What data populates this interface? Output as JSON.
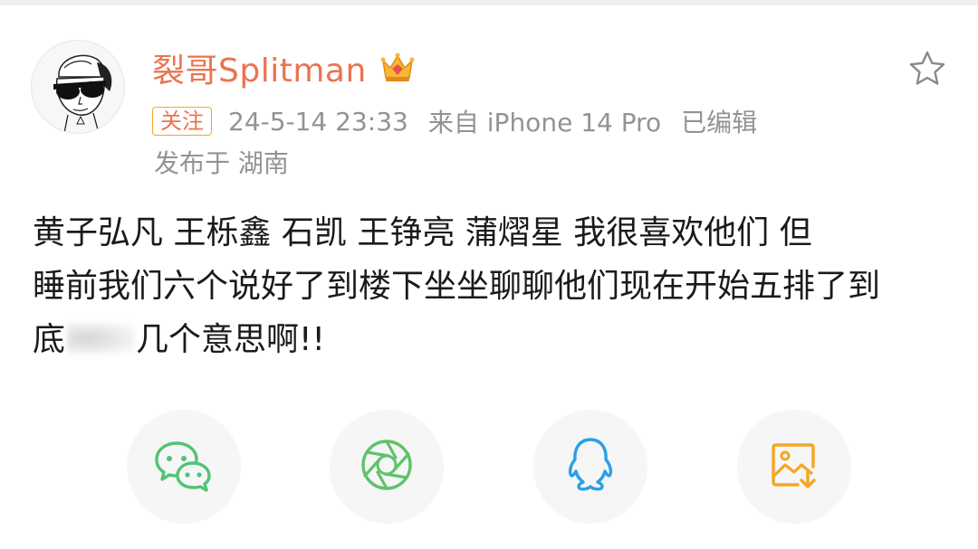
{
  "post": {
    "username": "裂哥Splitman",
    "follow_label": "关注",
    "timestamp": "24-5-14 23:33",
    "source": "来自 iPhone 14 Pro",
    "edited": "已编辑",
    "location": "发布于 湖南",
    "content_part1": "黄子弘凡  王栎鑫  石凯  王铮亮  蒲熠星  我很喜欢他们   但\n睡前我们六个说好了到楼下坐坐聊聊他们现在开始五排了到\n底",
    "content_part2": "几个意思啊!!"
  },
  "icons": {
    "verified_badge": "crown-icon",
    "favorite": "star-icon",
    "share_wechat": "wechat-icon",
    "share_moments": "moments-icon",
    "share_qq": "qq-icon",
    "save_image": "save-image-icon"
  },
  "colors": {
    "username": "#eb7350",
    "follow_border": "#f5a623",
    "meta": "#939393",
    "wechat": "#52c374",
    "moments": "#5fc26a",
    "qq": "#2b9ee9",
    "save": "#f5a623"
  }
}
